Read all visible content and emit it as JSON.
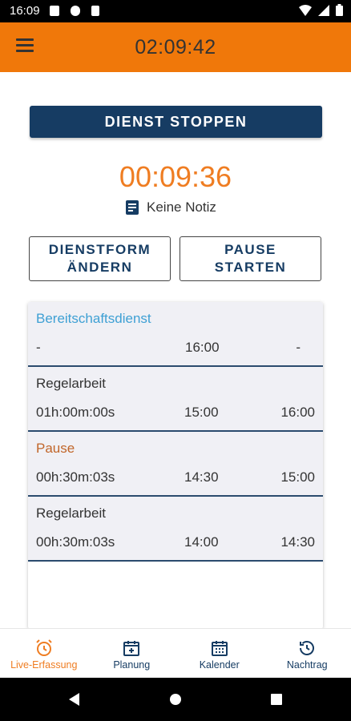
{
  "status_bar": {
    "time": "16:09"
  },
  "app_bar": {
    "title": "02:09:42"
  },
  "actions": {
    "stop_label": "DIENST STOPPEN",
    "change_type_label": [
      "DIENSTFORM",
      "ÄNDERN"
    ],
    "pause_label": [
      "PAUSE",
      "STARTEN"
    ]
  },
  "timer": "00:09:36",
  "note": "Keine Notiz",
  "entries": [
    {
      "type": "Bereitschaftsdienst",
      "duration": "-",
      "start": "16:00",
      "end": "-",
      "color": "#3ea0d4"
    },
    {
      "type": "Regelarbeit",
      "duration": "01h:00m:00s",
      "start": "15:00",
      "end": "16:00",
      "color": "#333333"
    },
    {
      "type": "Pause",
      "duration": "00h:30m:03s",
      "start": "14:30",
      "end": "15:00",
      "color": "#c1662a"
    },
    {
      "type": "Regelarbeit",
      "duration": "00h:30m:03s",
      "start": "14:00",
      "end": "14:30",
      "color": "#333333"
    }
  ],
  "bottom_nav": [
    {
      "label": "Live-Erfassung",
      "icon": "alarm-clock-icon",
      "active": true
    },
    {
      "label": "Planung",
      "icon": "calendar-plus-icon",
      "active": false
    },
    {
      "label": "Kalender",
      "icon": "calendar-icon",
      "active": false
    },
    {
      "label": "Nachtrag",
      "icon": "history-icon",
      "active": false
    }
  ],
  "colors": {
    "accent": "#f0780a",
    "primary": "#163c63",
    "timer": "#ef7d22"
  }
}
